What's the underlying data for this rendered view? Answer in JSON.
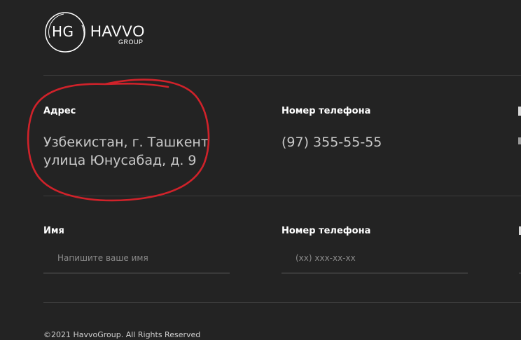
{
  "brand": {
    "mark": "HG",
    "name": "HAVVO",
    "sub": "GROUP"
  },
  "contact": {
    "address_label": "Адрес",
    "address_line1": "Узбекистан, г. Ташкент",
    "address_line2": "улица Юнусабад, д. 9",
    "phone_label": "Номер телефона",
    "phone_value": "(97) 355-55-55"
  },
  "form": {
    "name_label": "Имя",
    "name_placeholder": "Напишите ваше имя",
    "phone_label": "Номер телефона",
    "phone_placeholder": "(xx) xxx-xx-xx"
  },
  "footer": {
    "copyright": "©2021 HavvoGroup. All Rights Reserved"
  },
  "colors": {
    "background": "#232323",
    "annotation": "#d0222a"
  }
}
